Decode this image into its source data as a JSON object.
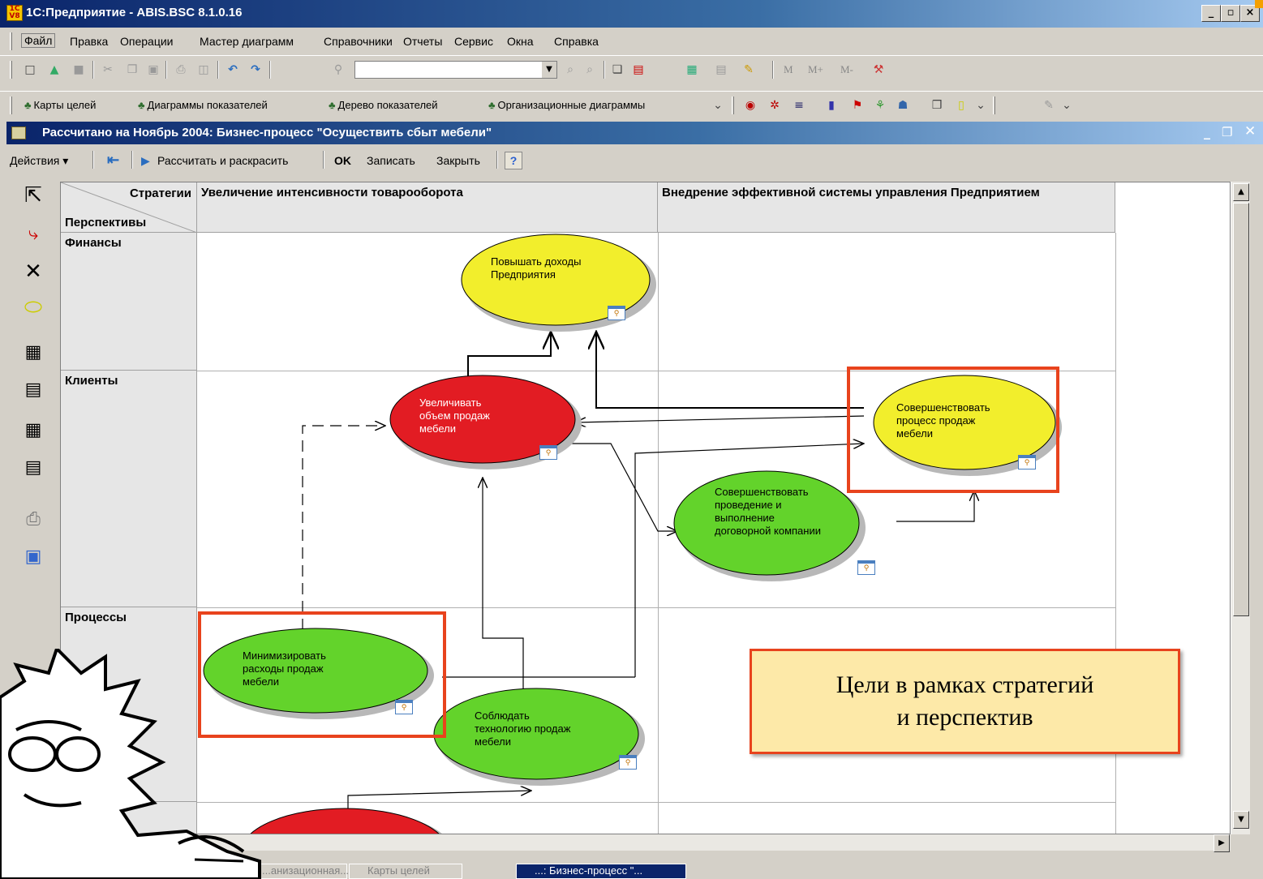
{
  "app": {
    "title": "1С:Предприятие - ABIS.BSC 8.1.0.16",
    "icon_text": "1C V8",
    "window_buttons": {
      "minimize": "_",
      "maximize": "▫",
      "close": "×"
    }
  },
  "menu": {
    "items": [
      "Файл",
      "Правка",
      "Операции",
      "Мастер диаграмм",
      "Справочники",
      "Отчеты",
      "Сервис",
      "Окна",
      "Справка"
    ]
  },
  "toolbar3": {
    "items": [
      "Карты целей",
      "Диаграммы показателей",
      "Дерево показателей",
      "Организационные диаграммы"
    ]
  },
  "toolbar2": {
    "mem_buttons": [
      "M",
      "M+",
      "M-"
    ]
  },
  "document": {
    "title": "Рассчитано на Ноябрь 2004: Бизнес-процесс \"Осуществить сбыт мебели\"",
    "actions": {
      "menu": "Действия ▾",
      "calculate": "Рассчитать и раскрасить",
      "ok": "OK",
      "save": "Записать",
      "close": "Закрыть",
      "help": "?"
    }
  },
  "grid": {
    "corner_top": "Стратегии",
    "corner_bottom": "Перспективы",
    "strategies": [
      "Увеличение интенсивности товарооборота",
      "Внедрение эффективной системы управления Предприятием"
    ],
    "perspectives": [
      "Финансы",
      "Клиенты",
      "Процессы"
    ]
  },
  "nodes": [
    {
      "id": "n1",
      "lines": [
        "Повышать доходы",
        "Предприятия"
      ],
      "color": "#f2ee2c"
    },
    {
      "id": "n2",
      "lines": [
        "Увеличивать",
        "объем продаж",
        "мебели"
      ],
      "color": "#e21c23"
    },
    {
      "id": "n3",
      "lines": [
        "Совершенствовать",
        "процесс продаж",
        "мебели"
      ],
      "color": "#f2ee2c"
    },
    {
      "id": "n4",
      "lines": [
        "Совершенствовать",
        "проведение и",
        "выполнение",
        "договорной компании"
      ],
      "color": "#63d32b"
    },
    {
      "id": "n5",
      "lines": [
        "Минимизировать",
        "расходы продаж",
        "мебели"
      ],
      "color": "#63d32b"
    },
    {
      "id": "n6",
      "lines": [
        "Соблюдать",
        "технологию продаж",
        "мебели"
      ],
      "color": "#63d32b"
    },
    {
      "id": "n7",
      "lines": [],
      "color": "#e21c23"
    }
  ],
  "callout": {
    "line1": "Цели в рамках стратегий",
    "line2": "и перспектив"
  },
  "taskbar": {
    "items": [
      "...анизационная...",
      "Карты целей",
      "...: Бизнес-процесс \"..."
    ]
  }
}
